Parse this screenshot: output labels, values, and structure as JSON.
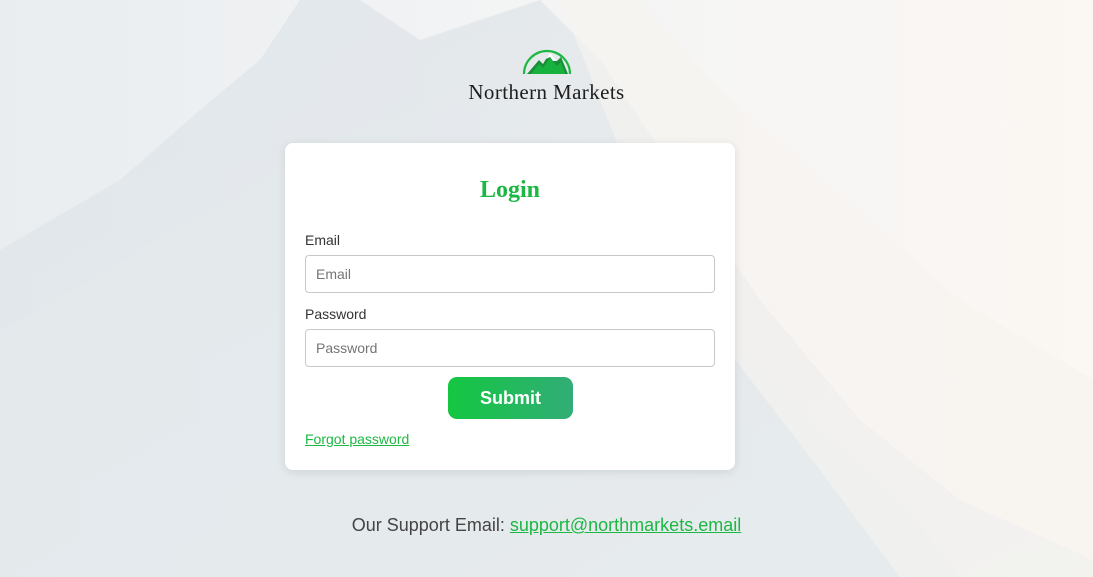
{
  "brand": {
    "name": "Northern Markets",
    "accent_color": "#1cb843"
  },
  "login": {
    "title": "Login",
    "email_label": "Email",
    "email_placeholder": "Email",
    "email_value": "",
    "password_label": "Password",
    "password_placeholder": "Password",
    "password_value": "",
    "submit_label": "Submit",
    "forgot_label": "Forgot password"
  },
  "footer": {
    "support_prefix": "Our Support Email:",
    "support_email": "support@northmarkets.email"
  },
  "icons": {
    "logo": "mountain-logo-icon"
  }
}
